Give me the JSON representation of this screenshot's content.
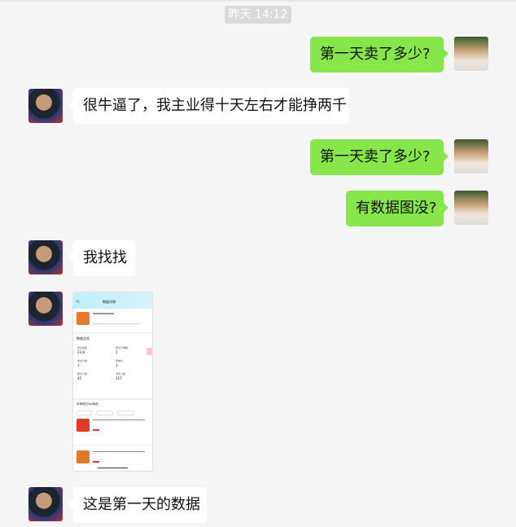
{
  "timestamp": "昨天 14:12",
  "messages": [
    {
      "side": "me",
      "text": "第一天卖了多少?"
    },
    {
      "side": "them",
      "text": "很牛逼了，我主业得十天左右才能挣两千"
    },
    {
      "side": "me",
      "text": "第一天卖了多少?"
    },
    {
      "side": "me",
      "text": "有数据图没?"
    },
    {
      "side": "them",
      "text": "我找找"
    },
    {
      "side": "them",
      "type": "image"
    },
    {
      "side": "them",
      "text": "这是第一天的数据"
    }
  ],
  "screenshot": {
    "page_title": "数据详情",
    "section_title": "数据总览",
    "stats": [
      {
        "label": "成交金额",
        "value": "23.8"
      },
      {
        "label": "成交订单数",
        "value": "1"
      },
      {
        "label": "成交人数",
        "value": "1"
      },
      {
        "label": "客单价",
        "value": "3"
      },
      {
        "label": "曝光人数",
        "value": "45"
      },
      {
        "label": "浏览人数",
        "value": "157"
      }
    ],
    "list_title": "本场成交Top商品"
  },
  "colors": {
    "me_bubble": "#86e64a",
    "them_bubble": "#ffffff",
    "background": "#f5f5f5"
  }
}
